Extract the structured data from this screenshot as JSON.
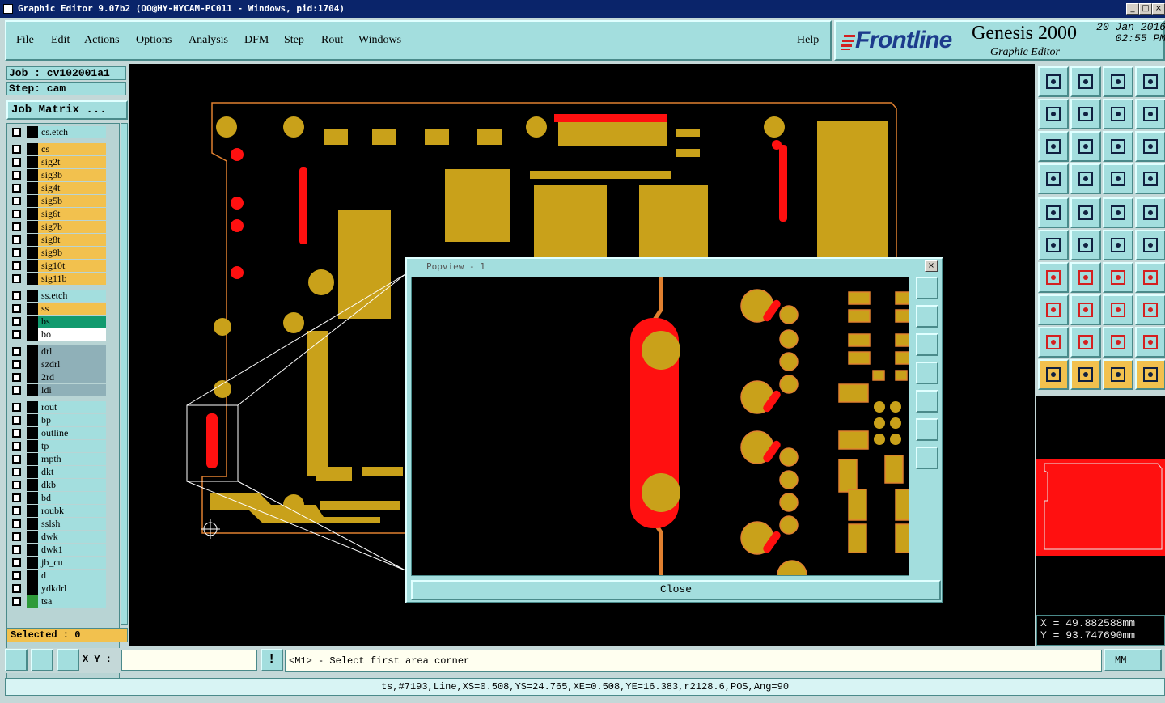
{
  "window": {
    "title": "Graphic Editor 9.07b2 (OO@HY-HYCAM-PC011 - Windows, pid:1704)",
    "buttons": [
      "_",
      "□",
      "×"
    ]
  },
  "menu": {
    "items": [
      "File",
      "Edit",
      "Actions",
      "Options",
      "Analysis",
      "DFM",
      "Step",
      "Rout",
      "Windows"
    ],
    "help": "Help"
  },
  "brand": {
    "logo": "Frontline",
    "product": "Genesis 2000",
    "subtitle": "Graphic Editor",
    "date": "20 Jan 2016",
    "time": "02:55 PM"
  },
  "job": {
    "job_label": "Job : cv102001a1",
    "step_label": "Step: cam",
    "matrix_button": "Job Matrix ..."
  },
  "layers": [
    {
      "name": "cs.etch",
      "bg": "#a3dede",
      "swatch": "#000"
    },
    {
      "name": "cs",
      "bg": "#f2c14e",
      "swatch": "#000"
    },
    {
      "name": "sig2t",
      "bg": "#f2c14e",
      "swatch": "#000"
    },
    {
      "name": "sig3b",
      "bg": "#f2c14e",
      "swatch": "#000"
    },
    {
      "name": "sig4t",
      "bg": "#f2c14e",
      "swatch": "#000"
    },
    {
      "name": "sig5b",
      "bg": "#f2c14e",
      "swatch": "#000"
    },
    {
      "name": "sig6t",
      "bg": "#f2c14e",
      "swatch": "#000"
    },
    {
      "name": "sig7b",
      "bg": "#f2c14e",
      "swatch": "#000"
    },
    {
      "name": "sig8t",
      "bg": "#f2c14e",
      "swatch": "#000"
    },
    {
      "name": "sig9b",
      "bg": "#f2c14e",
      "swatch": "#000"
    },
    {
      "name": "sig10t",
      "bg": "#f2c14e",
      "swatch": "#000"
    },
    {
      "name": "sig11b",
      "bg": "#f2c14e",
      "swatch": "#000"
    },
    {
      "name": "ss.etch",
      "bg": "#a3dede",
      "swatch": "#000"
    },
    {
      "name": "ss",
      "bg": "#f2c14e",
      "swatch": "#000"
    },
    {
      "name": "bs",
      "bg": "#129a6e",
      "swatch": "#000"
    },
    {
      "name": "bo",
      "bg": "#ffffff",
      "swatch": "#000"
    },
    {
      "name": "drl",
      "bg": "#8fb0b8",
      "swatch": "#000"
    },
    {
      "name": "szdrl",
      "bg": "#8fb0b8",
      "swatch": "#000"
    },
    {
      "name": "2rd",
      "bg": "#8fb0b8",
      "swatch": "#000"
    },
    {
      "name": "ldi",
      "bg": "#8fb0b8",
      "swatch": "#000"
    },
    {
      "name": "rout",
      "bg": "#a3dede",
      "swatch": "#000"
    },
    {
      "name": "bp",
      "bg": "#a3dede",
      "swatch": "#000"
    },
    {
      "name": "outline",
      "bg": "#a3dede",
      "swatch": "#000"
    },
    {
      "name": "tp",
      "bg": "#a3dede",
      "swatch": "#000"
    },
    {
      "name": "mpth",
      "bg": "#a3dede",
      "swatch": "#000"
    },
    {
      "name": "dkt",
      "bg": "#a3dede",
      "swatch": "#000"
    },
    {
      "name": "dkb",
      "bg": "#a3dede",
      "swatch": "#000"
    },
    {
      "name": "bd",
      "bg": "#a3dede",
      "swatch": "#000"
    },
    {
      "name": "roubk",
      "bg": "#a3dede",
      "swatch": "#000"
    },
    {
      "name": "sslsh",
      "bg": "#a3dede",
      "swatch": "#000"
    },
    {
      "name": "dwk",
      "bg": "#a3dede",
      "swatch": "#000"
    },
    {
      "name": "dwk1",
      "bg": "#a3dede",
      "swatch": "#000"
    },
    {
      "name": "jb_cu",
      "bg": "#a3dede",
      "swatch": "#000"
    },
    {
      "name": "d",
      "bg": "#a3dede",
      "swatch": "#000"
    },
    {
      "name": "ydkdrl",
      "bg": "#a3dede",
      "swatch": "#000"
    },
    {
      "name": "tsa",
      "bg": "#a3dede",
      "swatch": "#2e9a3a"
    }
  ],
  "selected_label": "Selected : 0",
  "popview": {
    "title": "Popview - 1",
    "close_label": "Close"
  },
  "coords": {
    "x": "X = 49.882588mm",
    "y": "Y = 93.747690mm"
  },
  "bottom": {
    "xy_label": "X Y :",
    "xy_value": "",
    "prompt": "<M1> - Select first area corner",
    "units": "MM"
  },
  "status": "ts,#7193,Line,XS=0.508,YS=24.765,XE=0.508,YE=16.383,r2128.6,POS,Ang=90",
  "colors": {
    "teal": "#a3dede",
    "copper": "#c9a11a",
    "red": "#ff1010",
    "outline": "#e08030"
  }
}
